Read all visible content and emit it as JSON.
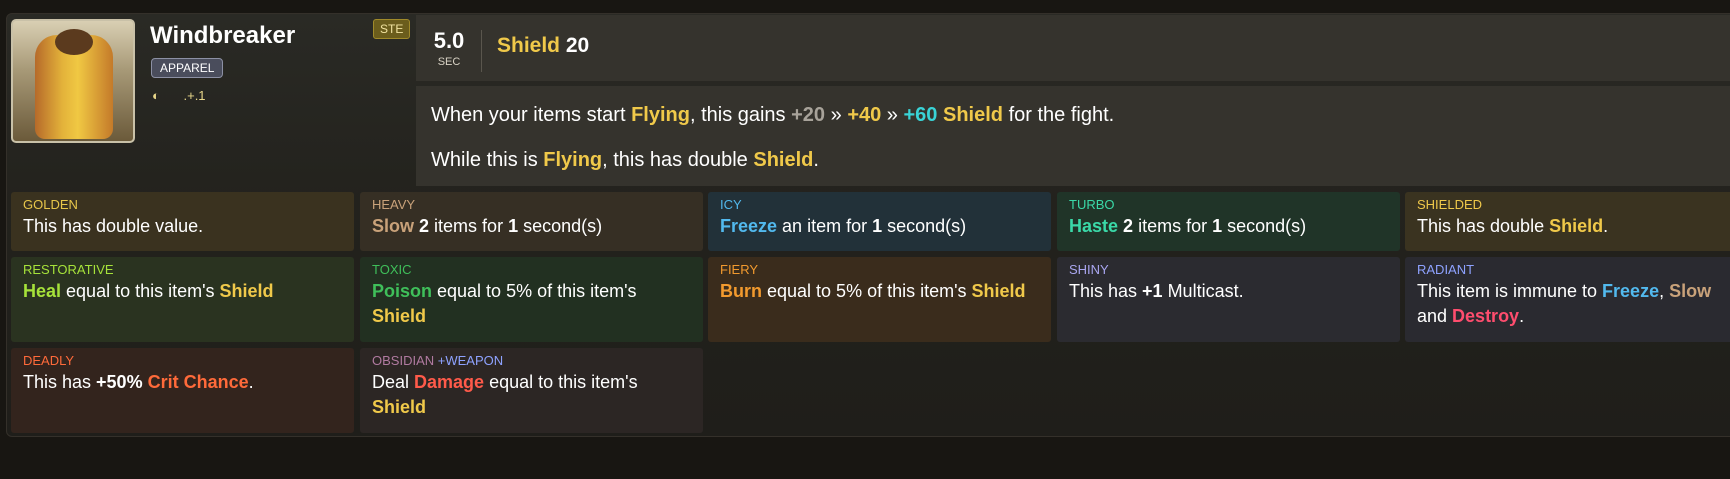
{
  "item": {
    "name": "Windbreaker",
    "size_badge": "STE",
    "type_badge": "APPAREL",
    "tier_icon": "shield-icon",
    "tier_text": ".+.1"
  },
  "stats": {
    "cooldown_value": "5.0",
    "cooldown_unit": "SEC",
    "shield_label": "Shield",
    "shield_value": "20"
  },
  "description": {
    "line1": {
      "a": "When your items start ",
      "flying": "Flying",
      "b": ", this gains ",
      "v1": "+20",
      "s1": " » ",
      "v2": "+40",
      "s2": " » ",
      "v3": "+60",
      "sp": " ",
      "shield": "Shield",
      "c": " for the fight."
    },
    "line2": {
      "a": "While this is ",
      "flying": "Flying",
      "b": ", this has double ",
      "shield": "Shield",
      "c": "."
    }
  },
  "enchantments": [
    {
      "label": "GOLDEN",
      "label_color": "#e7c64a",
      "bg": "#3a321f"
    },
    {
      "label": "HEAVY",
      "label_color": "#c9a27a",
      "bg": "#362f24"
    },
    {
      "label": "ICY",
      "label_color": "#52b9ee",
      "bg": "#223139"
    },
    {
      "label": "TURBO",
      "label_color": "#3ad9a8",
      "bg": "#203428"
    },
    {
      "label": "SHIELDED",
      "label_color": "#f0c94a",
      "bg": "#3a3320"
    },
    {
      "label": "RESTORATIVE",
      "label_color": "#a6e23a",
      "bg": "#2a3320"
    },
    {
      "label": "TOXIC",
      "label_color": "#3fbf5a",
      "bg": "#223021"
    },
    {
      "label": "FIERY",
      "label_color": "#f29a2e",
      "bg": "#3a2c1c"
    },
    {
      "label": "SHINY",
      "label_color": "#a9a6f0",
      "bg": "#2b2b30"
    },
    {
      "label": "RADIANT",
      "label_color": "#8ea2ff",
      "bg": "#2a2a30"
    },
    {
      "label": "DEADLY",
      "label_color": "#ff6a3a",
      "bg": "#33241d"
    },
    {
      "label": "OBSIDIAN",
      "label_color": "#b07aa0",
      "bg": "#2c2624",
      "extra": "+WEAPON",
      "extra_color": "#8ea2ff"
    }
  ],
  "texts": {
    "golden": "This has double value.",
    "heavy": {
      "a": "Slow",
      "b": " ",
      "n": "2",
      "c": " items for ",
      "m": "1",
      "d": " second(s)"
    },
    "icy": {
      "a": "Freeze",
      "b": " an item for ",
      "m": "1",
      "d": " second(s)"
    },
    "turbo": {
      "a": "Haste",
      "b": " ",
      "n": "2",
      "c": " items for ",
      "m": "1",
      "d": " second(s)"
    },
    "shielded": {
      "a": "This has double ",
      "s": "Shield",
      "d": "."
    },
    "restorative": {
      "a": "Heal",
      "b": " equal to this item's ",
      "s": "Shield"
    },
    "toxic": {
      "a": "Poison",
      "b": " equal to 5% of this item's ",
      "s": "Shield"
    },
    "fiery": {
      "a": "Burn",
      "b": " equal to 5% of this item's ",
      "s": "Shield"
    },
    "shiny": {
      "a": "This has ",
      "n": "+1",
      "b": " Multicast."
    },
    "radiant": {
      "a": "This item is immune to ",
      "f": "Freeze",
      "b": ", ",
      "s": "Slow",
      "c": " and ",
      "d": "Destroy",
      "e": "."
    },
    "deadly": {
      "a": "This has ",
      "n": "+50%",
      "sp": " ",
      "k": "Crit Chance",
      "d": "."
    },
    "obsidian": {
      "a": "Deal ",
      "k": "Damage",
      "b": " equal to this item's ",
      "s": "Shield"
    }
  }
}
